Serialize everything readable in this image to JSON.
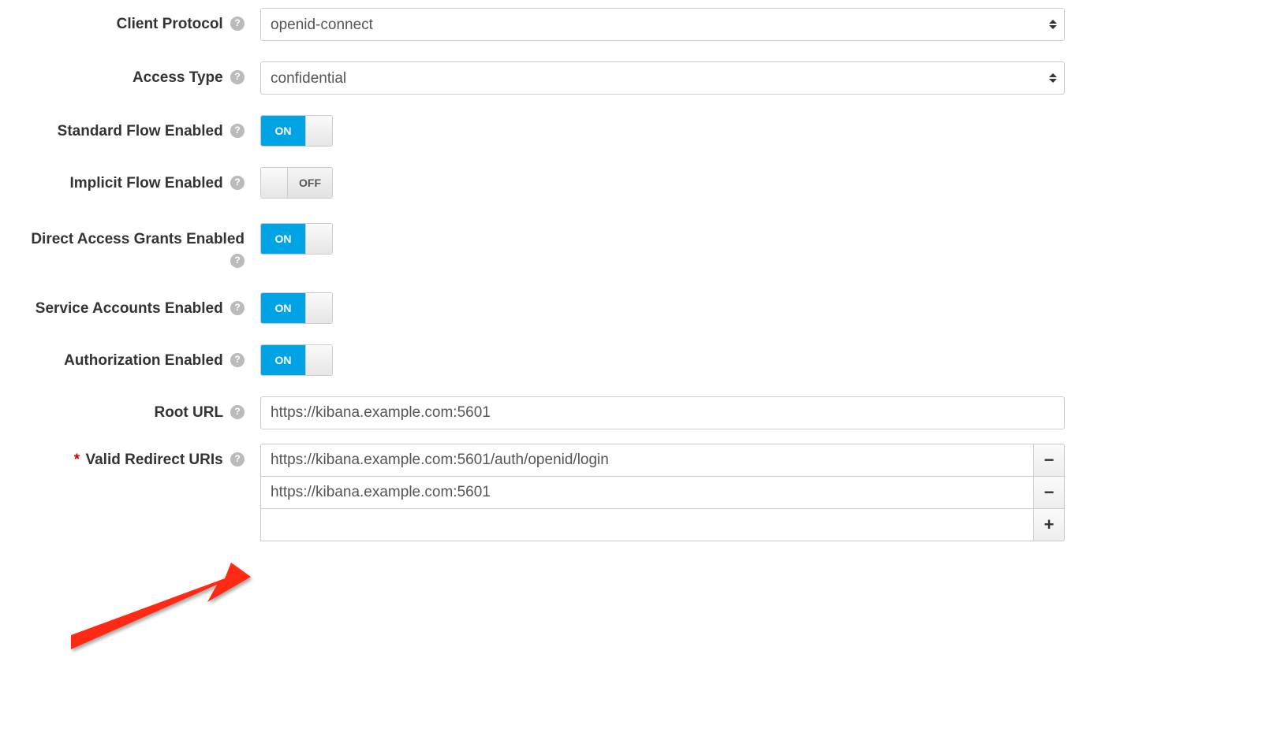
{
  "labels": {
    "clientProtocol": "Client Protocol",
    "accessType": "Access Type",
    "standardFlow": "Standard Flow Enabled",
    "implicitFlow": "Implicit Flow Enabled",
    "directAccess": "Direct Access Grants Enabled",
    "serviceAccounts": "Service Accounts Enabled",
    "authorization": "Authorization Enabled",
    "rootUrl": "Root URL",
    "validRedirectUris": "Valid Redirect URIs"
  },
  "values": {
    "clientProtocol": "openid-connect",
    "accessType": "confidential",
    "rootUrl": "https://kibana.example.com:5601",
    "redirectUris": {
      "0": "https://kibana.example.com:5601/auth/openid/login",
      "1": "https://kibana.example.com:5601",
      "2": ""
    }
  },
  "toggles": {
    "on": "ON",
    "off": "OFF",
    "standardFlow": true,
    "implicitFlow": false,
    "directAccess": true,
    "serviceAccounts": true,
    "authorization": true
  },
  "icons": {
    "minus": "−",
    "plus": "+"
  }
}
